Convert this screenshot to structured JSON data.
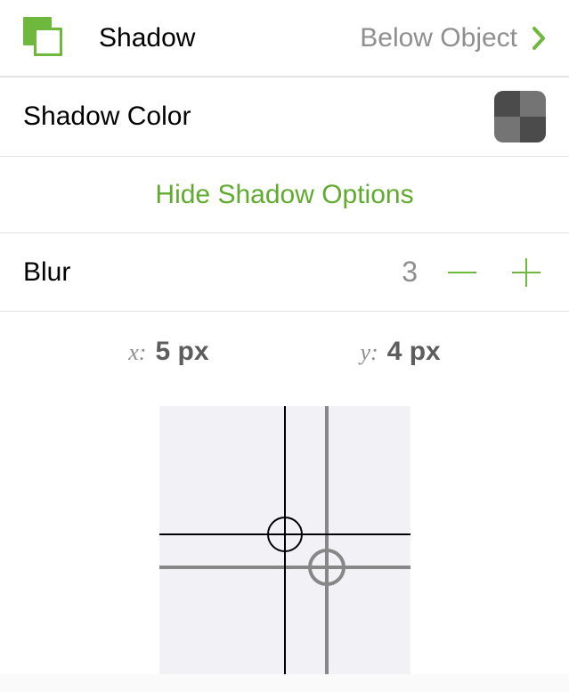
{
  "shadow": {
    "label": "Shadow",
    "value": "Below Object"
  },
  "color": {
    "label": "Shadow Color"
  },
  "toggle": {
    "label": "Hide Shadow Options"
  },
  "blur": {
    "label": "Blur",
    "value": "3"
  },
  "offset": {
    "x_label": "x:",
    "x_value": "5 px",
    "y_label": "y:",
    "y_value": "4 px"
  }
}
